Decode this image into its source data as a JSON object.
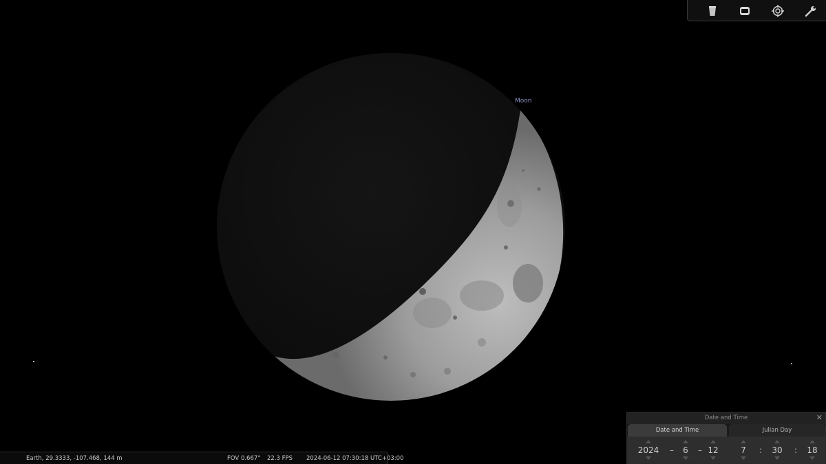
{
  "sky": {
    "target_label": "Moon"
  },
  "toolbar": {
    "buttons": [
      {
        "name": "sky-and-viewing-options",
        "icon": "trash-can-icon"
      },
      {
        "name": "fullscreen-toggle",
        "icon": "screen-icon"
      },
      {
        "name": "target-selection",
        "icon": "target-icon"
      },
      {
        "name": "settings",
        "icon": "wrench-icon"
      }
    ]
  },
  "status": {
    "location": "Earth, 29.3333, -107.468, 144 m",
    "fov": "FOV 0.667°",
    "fps": "22.3 FPS",
    "datetime": "2024-06-12 07:30:18 UTC+03:00"
  },
  "date_time_window": {
    "title": "Date and Time",
    "tabs": [
      "Date and Time",
      "Julian Day"
    ],
    "year": "2024",
    "month": "6",
    "day": "12",
    "hour": "7",
    "minute": "30",
    "second": "18",
    "date_sep": "–",
    "time_sep": ":"
  },
  "colors": {
    "background": "#000000",
    "label": "#8f93c4",
    "panel": "#2e2e2e"
  }
}
